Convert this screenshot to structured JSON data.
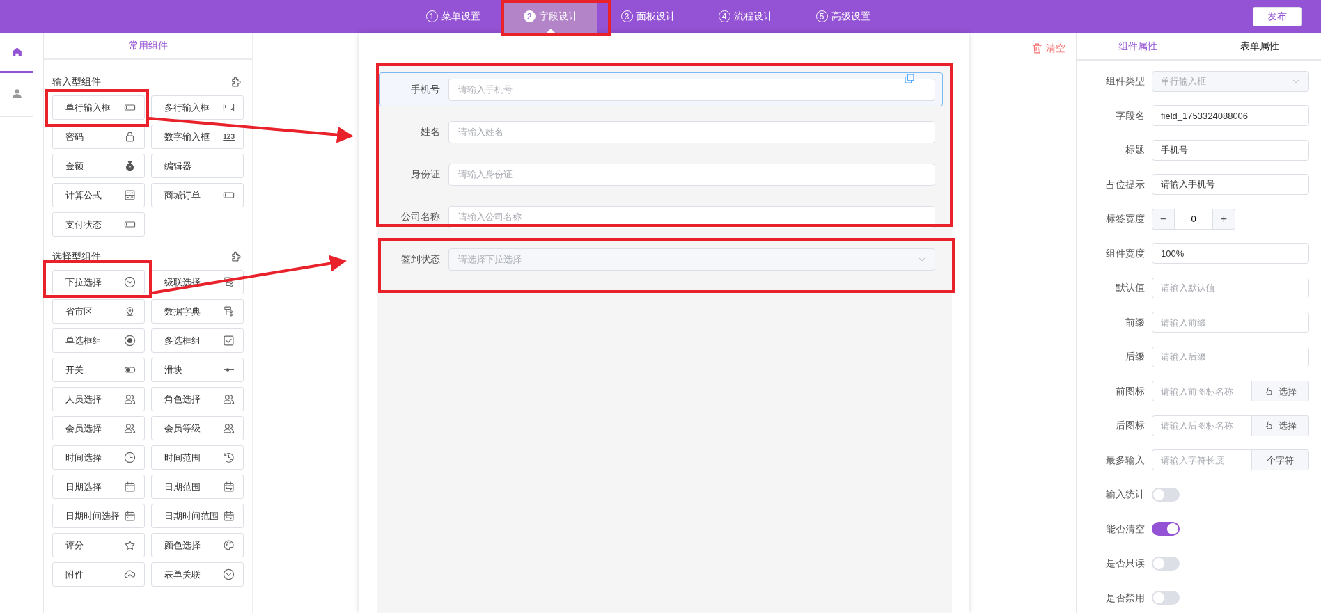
{
  "top_bar": {
    "steps": [
      {
        "number": "1",
        "label": "菜单设置",
        "selected": false
      },
      {
        "number": "2",
        "label": "字段设计",
        "selected": true
      },
      {
        "number": "3",
        "label": "面板设计",
        "selected": false
      },
      {
        "number": "4",
        "label": "流程设计",
        "selected": false
      },
      {
        "number": "5",
        "label": "高级设置",
        "selected": false
      }
    ],
    "publish_button": "发布"
  },
  "rail": [
    {
      "selected": true
    },
    {
      "selected": false
    }
  ],
  "component_panel": {
    "title": "常用组件",
    "groups": [
      {
        "title": "输入型组件",
        "items": [
          {
            "label": "单行输入框"
          },
          {
            "label": "多行输入框"
          },
          {
            "label": "密码"
          },
          {
            "label": "数字输入框",
            "icon_text": "123"
          },
          {
            "label": "金额"
          },
          {
            "label": "编辑器"
          },
          {
            "label": "计算公式"
          },
          {
            "label": "商城订单"
          },
          {
            "label": "支付状态"
          }
        ]
      },
      {
        "title": "选择型组件",
        "items": [
          {
            "label": "下拉选择"
          },
          {
            "label": "级联选择"
          },
          {
            "label": "省市区"
          },
          {
            "label": "数据字典"
          },
          {
            "label": "单选框组"
          },
          {
            "label": "多选框组"
          },
          {
            "label": "开关"
          },
          {
            "label": "滑块"
          },
          {
            "label": "人员选择"
          },
          {
            "label": "角色选择"
          },
          {
            "label": "会员选择"
          },
          {
            "label": "会员等级"
          },
          {
            "label": "时间选择"
          },
          {
            "label": "时间范围"
          },
          {
            "label": "日期选择"
          },
          {
            "label": "日期范围"
          },
          {
            "label": "日期时间选择"
          },
          {
            "label": "日期时间范围"
          },
          {
            "label": "评分"
          },
          {
            "label": "颜色选择"
          },
          {
            "label": "附件"
          },
          {
            "label": "表单关联"
          }
        ]
      }
    ]
  },
  "canvas": {
    "clear_button": "清空",
    "fields": [
      {
        "label": "手机号",
        "kind": "input",
        "placeholder": "请输入手机号",
        "selected": true
      },
      {
        "label": "姓名",
        "kind": "input",
        "placeholder": "请输入姓名",
        "selected": false
      },
      {
        "label": "身份证",
        "kind": "input",
        "placeholder": "请输入身份证",
        "selected": false
      },
      {
        "label": "公司名称",
        "kind": "input",
        "placeholder": "请输入公司名称",
        "selected": false
      },
      {
        "label": "签到状态",
        "kind": "select",
        "placeholder": "请选择下拉选择",
        "selected": false,
        "disabled": true
      }
    ]
  },
  "properties": {
    "tabs": [
      {
        "label": "组件属性",
        "selected": true
      },
      {
        "label": "表单属性",
        "selected": false
      }
    ],
    "rows": [
      {
        "label": "组件类型",
        "kind": "select",
        "value": "单行输入框",
        "disabled": true
      },
      {
        "label": "字段名",
        "kind": "text",
        "value": "field_1753324088006"
      },
      {
        "label": "标题",
        "kind": "text",
        "value": "手机号"
      },
      {
        "label": "占位提示",
        "kind": "text",
        "value": "请输入手机号"
      },
      {
        "label": "标签宽度",
        "kind": "stepper",
        "value": "0",
        "minus": "−",
        "plus": "+"
      },
      {
        "label": "组件宽度",
        "kind": "text",
        "value": "100%"
      },
      {
        "label": "默认值",
        "kind": "text",
        "placeholder": "请输入默认值"
      },
      {
        "label": "前缀",
        "kind": "text",
        "placeholder": "请输入前缀"
      },
      {
        "label": "后缀",
        "kind": "text",
        "placeholder": "请输入后缀"
      },
      {
        "label": "前图标",
        "kind": "picker",
        "placeholder": "请输入前图标名称",
        "button": "选择"
      },
      {
        "label": "后图标",
        "kind": "picker",
        "placeholder": "请输入后图标名称",
        "button": "选择"
      },
      {
        "label": "最多输入",
        "kind": "append",
        "placeholder": "请输入字符长度",
        "addon": "个字符"
      },
      {
        "label": "输入统计",
        "kind": "switch",
        "on": false
      },
      {
        "label": "能否清空",
        "kind": "switch",
        "on": true
      },
      {
        "label": "是否只读",
        "kind": "switch",
        "on": false
      },
      {
        "label": "是否禁用",
        "kind": "switch",
        "on": false
      }
    ]
  }
}
